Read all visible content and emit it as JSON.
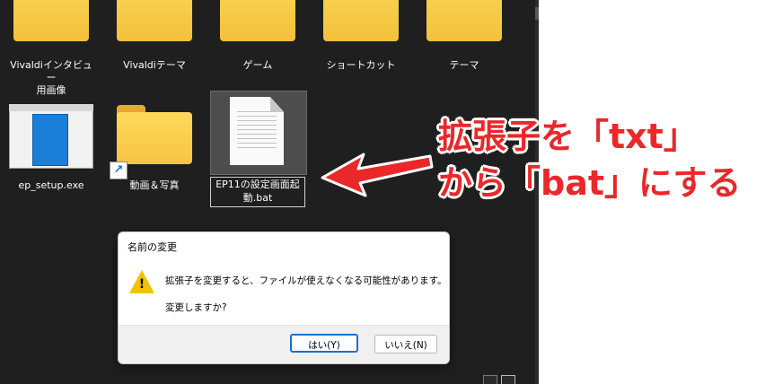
{
  "top_folders": [
    {
      "label": "Vivaldiインタビュー\n用画像"
    },
    {
      "label": "Vivaldiテーマ"
    },
    {
      "label": "ゲーム"
    },
    {
      "label": "ショートカット"
    },
    {
      "label": "テーマ"
    }
  ],
  "files": {
    "exe_label": "ep_setup.exe",
    "shortcut_label": "動画＆写真",
    "renaming_name": "EP11の設定画面起動.bat"
  },
  "annotation": {
    "line1": "拡張子を「txt」",
    "line2": "から「bat」にする",
    "color": "#e9282a"
  },
  "dialog": {
    "title": "名前の変更",
    "message": "拡張子を変更すると、ファイルが使えなくなる可能性があります。",
    "question": "変更しますか?",
    "yes_label": "はい(Y)",
    "no_label": "いいえ(N)"
  },
  "icons": {
    "warning": "warning-icon",
    "shortcut_arrow": "shortcut-arrow-icon"
  }
}
